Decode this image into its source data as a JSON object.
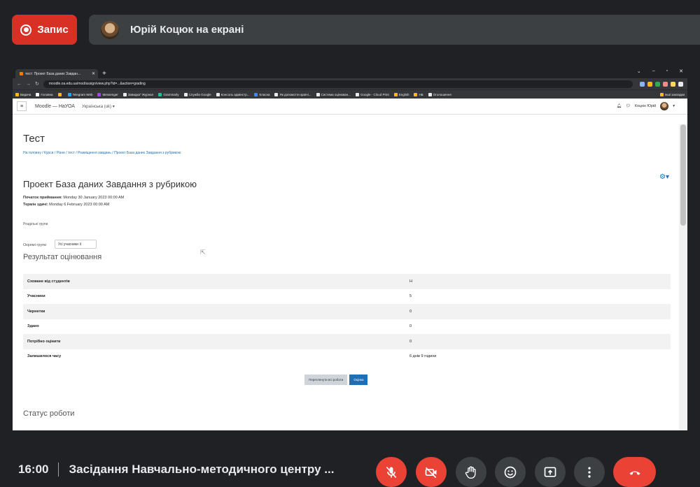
{
  "top": {
    "record_label": "Запис",
    "presenter": "Юрій Коцюк на екрані"
  },
  "browser": {
    "tab_title": "тест: Проект База даних Завдан...",
    "url": "moodle.oa.edu.ua/mod/assign/view.php?id=...&action=grading",
    "bookmarks": [
      "Видача",
      "Головна",
      "",
      "Telegram Web",
      "Messenger",
      "Завидка\" Журнал",
      "Grammarly",
      "Служби Google",
      "Консоль адмінстр...",
      "Класна",
      "Як допомогти країні...",
      "Система оцінюван...",
      "Google - Cloud Print",
      "English",
      "НБ",
      "Оголошення",
      "Інші закладки"
    ]
  },
  "moodle": {
    "site_name": "Moodle — НаУОА",
    "language": "Українська (uk) ▾",
    "user_name": "Коцюк Юрій",
    "course_title": "Тест",
    "breadcrumb": "На головну / Курси / Різне / тест / Розміщення завдань / Проект База даних Завдання з рубрикою",
    "assignment_title": "Проект База даних Завдання з рубрикою",
    "start_label": "Початок приймання:",
    "start_value": "Monday 30 January 2023 00:00 AM",
    "due_label": "Термін здачі:",
    "due_value": "Monday 6 February 2023 00:00 AM",
    "separate_groups": "Роздільні групи",
    "group_label": "Окремі групи",
    "group_select": "Усі учасники ⇕",
    "grading_summary_title": "Результат оцінювання",
    "summary_rows": [
      {
        "label": "Сховане від студентів",
        "value": "Н"
      },
      {
        "label": "Учасники",
        "value": "5"
      },
      {
        "label": "Чернетки",
        "value": "0"
      },
      {
        "label": "Здано",
        "value": "0"
      },
      {
        "label": "Потрібно оцінити",
        "value": "0"
      },
      {
        "label": "Залишилося часу",
        "value": "6 днів 9 години"
      }
    ],
    "view_all_button": "Переглянути всі роботи",
    "grade_button": "Оцінка",
    "submission_status_title": "Статус роботи"
  },
  "bottom": {
    "time": "16:00",
    "meeting_title": "Засідання Навчально-методичного центру ..."
  },
  "colors": {
    "record_red": "#d93025",
    "control_red": "#ea4335",
    "control_grey": "#3c4043",
    "moodle_blue": "#1f6fb5"
  }
}
